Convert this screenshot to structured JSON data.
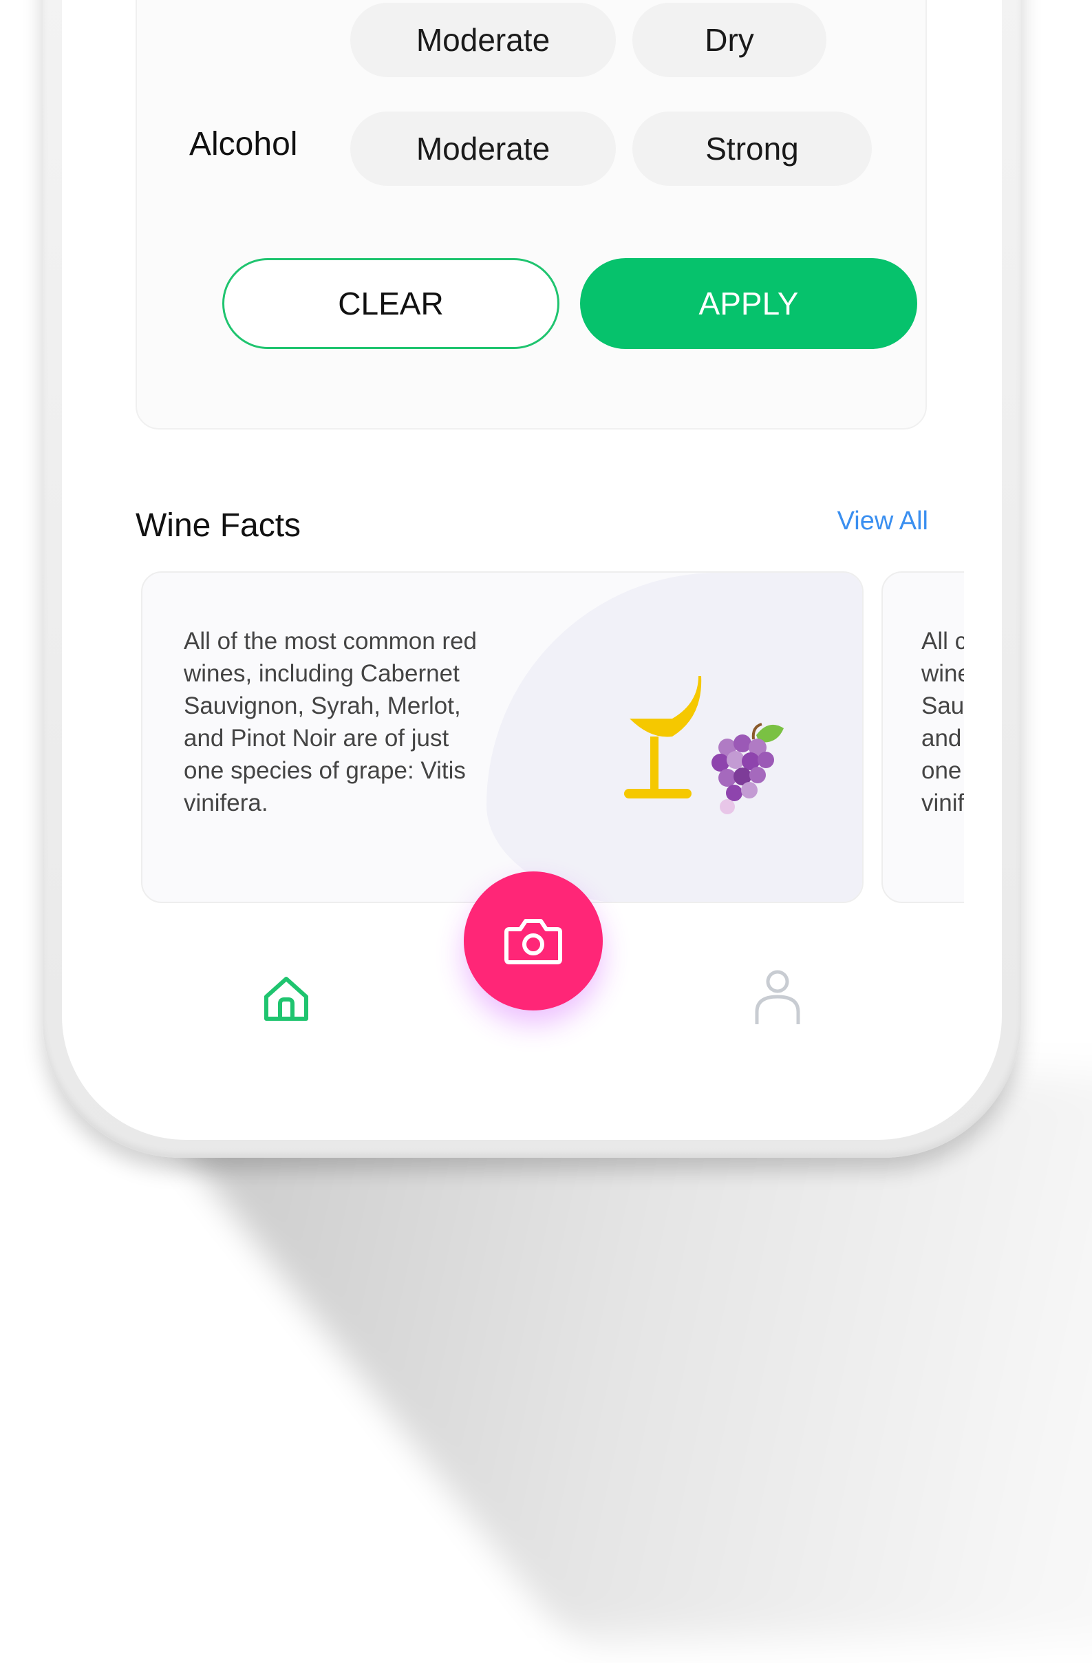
{
  "filters": {
    "sweetness_row": {
      "options": [
        "Moderate",
        "Dry"
      ]
    },
    "alcohol_row": {
      "label": "Alcohol",
      "options": [
        "Moderate",
        "Strong"
      ]
    },
    "clear_label": "CLEAR",
    "apply_label": "APPLY",
    "accent_color": "#06c26c"
  },
  "wine_facts": {
    "title": "Wine Facts",
    "view_all_label": "View All",
    "cards": [
      {
        "text": "All of the most common red\nwines, including Cabernet\nSauvignon, Syrah, Merlot,\nand Pinot Noir are of just\none species of grape: Vitis\nvinifera.",
        "illustration": "wine-glass-and-grapes-icon"
      },
      {
        "text": "All c\nwine\nSau\nand\none\nvinif"
      }
    ]
  },
  "bottom_nav": {
    "items": [
      {
        "icon": "home-icon",
        "active": true
      },
      {
        "icon": "camera-icon",
        "primary": true
      },
      {
        "icon": "profile-icon",
        "active": false
      }
    ],
    "active_color": "#1fc46f",
    "fab_color": "#ff2677"
  }
}
